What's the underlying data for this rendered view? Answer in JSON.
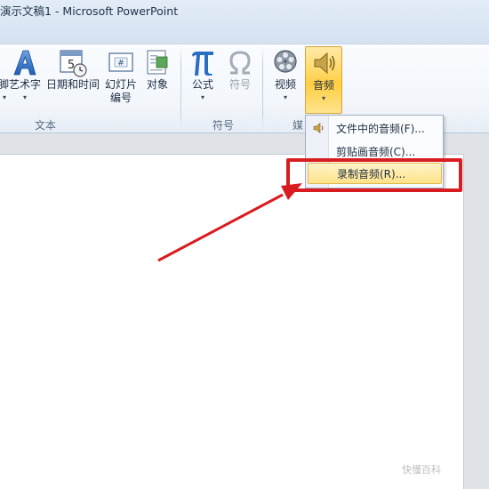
{
  "window": {
    "title": "演示文稿1 - Microsoft PowerPoint"
  },
  "ribbon": {
    "groups": [
      {
        "label": "文本"
      },
      {
        "label": "符号"
      },
      {
        "label": "媒"
      }
    ],
    "buttons": {
      "partial": {
        "label": "脚"
      },
      "wordart": {
        "label": "艺术字"
      },
      "datetime": {
        "label": "日期和时间"
      },
      "slide_number": {
        "label1": "幻灯片",
        "label2": "编号"
      },
      "object": {
        "label": "对象"
      },
      "equation": {
        "label": "公式"
      },
      "symbol": {
        "label": "符号"
      },
      "video": {
        "label": "视频"
      },
      "audio": {
        "label": "音频"
      }
    }
  },
  "audio_menu": {
    "items": [
      {
        "label": "文件中的音频(F)..."
      },
      {
        "label": "剪贴画音频(C)..."
      },
      {
        "label": "录制音频(R)..."
      }
    ],
    "highlighted_index": 2
  },
  "annotation": {
    "color": "#d91c20"
  },
  "watermark": {
    "text": "快懂百科"
  }
}
